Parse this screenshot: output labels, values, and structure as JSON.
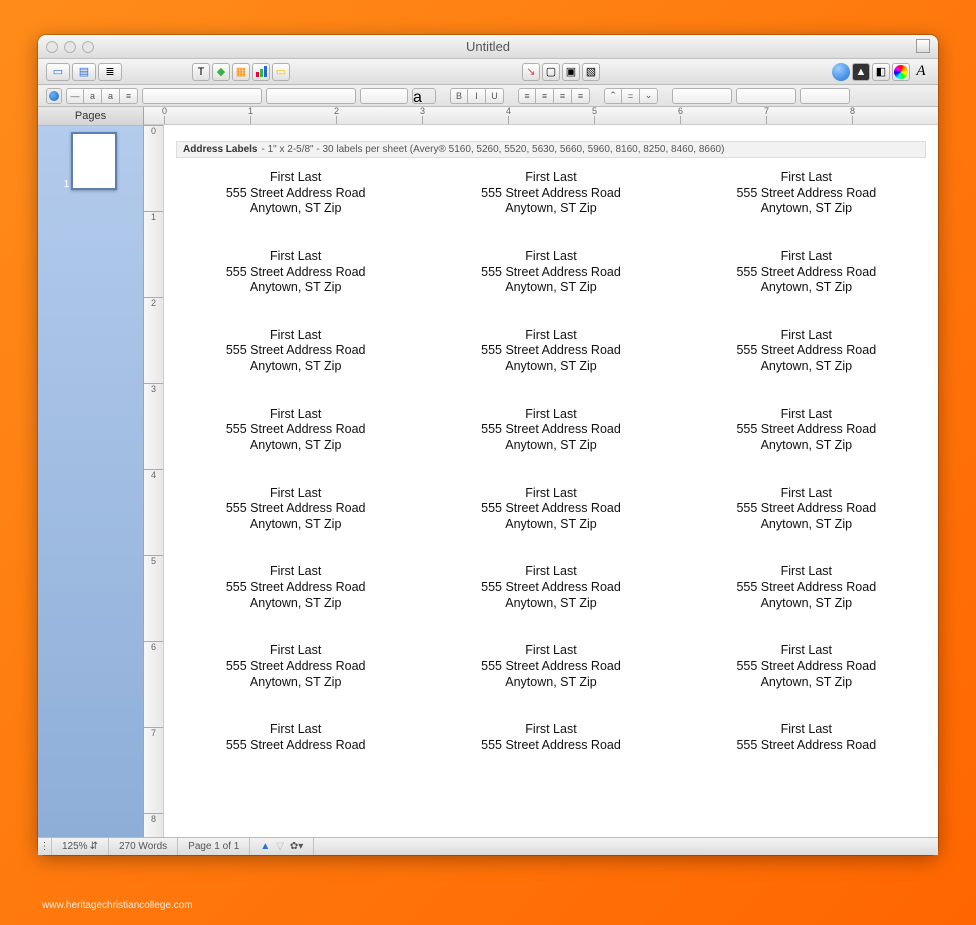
{
  "window": {
    "title": "Untitled"
  },
  "sidebar": {
    "title": "Pages",
    "page_number": "1"
  },
  "ruler": {
    "h_ticks": [
      "0",
      "1",
      "2",
      "3",
      "4",
      "5",
      "6",
      "7",
      "8"
    ],
    "v_ticks": [
      "0",
      "1",
      "2",
      "3",
      "4",
      "5",
      "6",
      "7",
      "8"
    ]
  },
  "info_bar": {
    "bold": "Address Labels",
    "rest": " - 1\" x 2-5/8\" - 30 labels per sheet (Avery®  5160, 5260, 5520, 5630, 5660, 5960, 8160, 8250, 8460, 8660)"
  },
  "address": {
    "name": "First Last",
    "street": "555 Street Address Road",
    "city": "Anytown, ST Zip"
  },
  "last_row": {
    "name": "First Last",
    "street": "555 Street Address Road"
  },
  "visible_full_rows": 7,
  "columns": 3,
  "status": {
    "zoom": "125%",
    "words": "270 Words",
    "page": "Page 1 of 1"
  },
  "fmt": {
    "bold": "B",
    "italic": "I",
    "underline": "U",
    "a": "a"
  },
  "watermark": "www.heritagechristiancollege.com"
}
